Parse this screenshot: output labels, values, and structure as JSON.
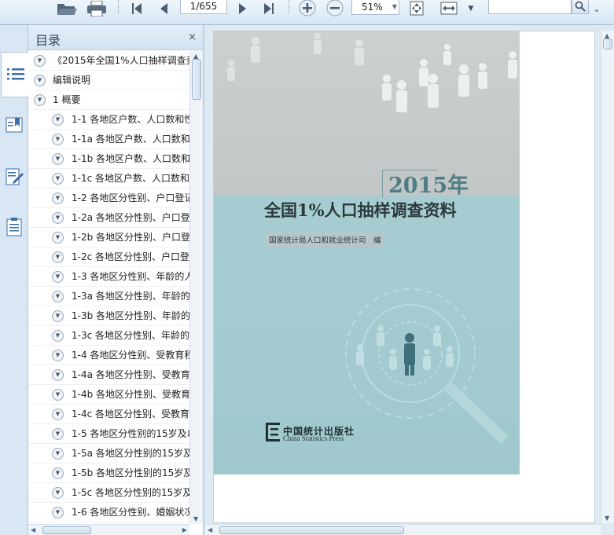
{
  "toolbar": {
    "page_value": "1/655",
    "zoom_value": "51%",
    "search_placeholder": ""
  },
  "toc": {
    "title": "目录",
    "close_label": "×",
    "items": [
      {
        "label": "《2015年全国1%人口抽样调查资",
        "level": 0
      },
      {
        "label": "编辑说明",
        "level": 0
      },
      {
        "label": "1 概要",
        "level": 0
      },
      {
        "label": "1-1 各地区户数、人口数和性",
        "level": 1
      },
      {
        "label": "1-1a 各地区户数、人口数和",
        "level": 1
      },
      {
        "label": "1-1b 各地区户数、人口数和",
        "level": 1
      },
      {
        "label": "1-1c 各地区户数、人口数和",
        "level": 1
      },
      {
        "label": "1-2 各地区分性别、户口登记",
        "level": 1
      },
      {
        "label": "1-2a 各地区分性别、户口登",
        "level": 1
      },
      {
        "label": "1-2b 各地区分性别、户口登",
        "level": 1
      },
      {
        "label": "1-2c 各地区分性别、户口登",
        "level": 1
      },
      {
        "label": "1-3 各地区分性别、年龄的人",
        "level": 1
      },
      {
        "label": "1-3a 各地区分性别、年龄的",
        "level": 1
      },
      {
        "label": "1-3b 各地区分性别、年龄的",
        "level": 1
      },
      {
        "label": "1-3c 各地区分性别、年龄的",
        "level": 1
      },
      {
        "label": "1-4 各地区分性别、受教育程",
        "level": 1
      },
      {
        "label": "1-4a 各地区分性别、受教育",
        "level": 1
      },
      {
        "label": "1-4b 各地区分性别、受教育",
        "level": 1
      },
      {
        "label": "1-4c 各地区分性别、受教育",
        "level": 1
      },
      {
        "label": "1-5 各地区分性别的15岁及以",
        "level": 1
      },
      {
        "label": "1-5a 各地区分性别的15岁及",
        "level": 1
      },
      {
        "label": "1-5b 各地区分性别的15岁及",
        "level": 1
      },
      {
        "label": "1-5c 各地区分性别的15岁及",
        "level": 1
      },
      {
        "label": "1-6 各地区分性别、婚姻状况",
        "level": 1
      }
    ]
  },
  "cover": {
    "year": "2015年",
    "title": "全国1%人口抽样调查资料",
    "editor": "国家统计局人口和就业统计司　编",
    "publisher_cn": "中国统计出版社",
    "publisher_en": "China Statistics Press"
  },
  "colors": {
    "toolbar_bg": "#d6e6f3",
    "cover_top": "#c2c6c6",
    "cover_bottom": "#a7cdd2"
  },
  "icons": [
    "open-file-icon",
    "print-icon",
    "first-page-icon",
    "previous-page-icon",
    "next-page-icon",
    "last-page-icon",
    "zoom-in-icon",
    "zoom-out-icon",
    "fit-page-icon",
    "fit-width-icon",
    "search-icon",
    "toc-list-icon",
    "bookmark-icon",
    "annotation-icon",
    "thumbnails-icon"
  ]
}
